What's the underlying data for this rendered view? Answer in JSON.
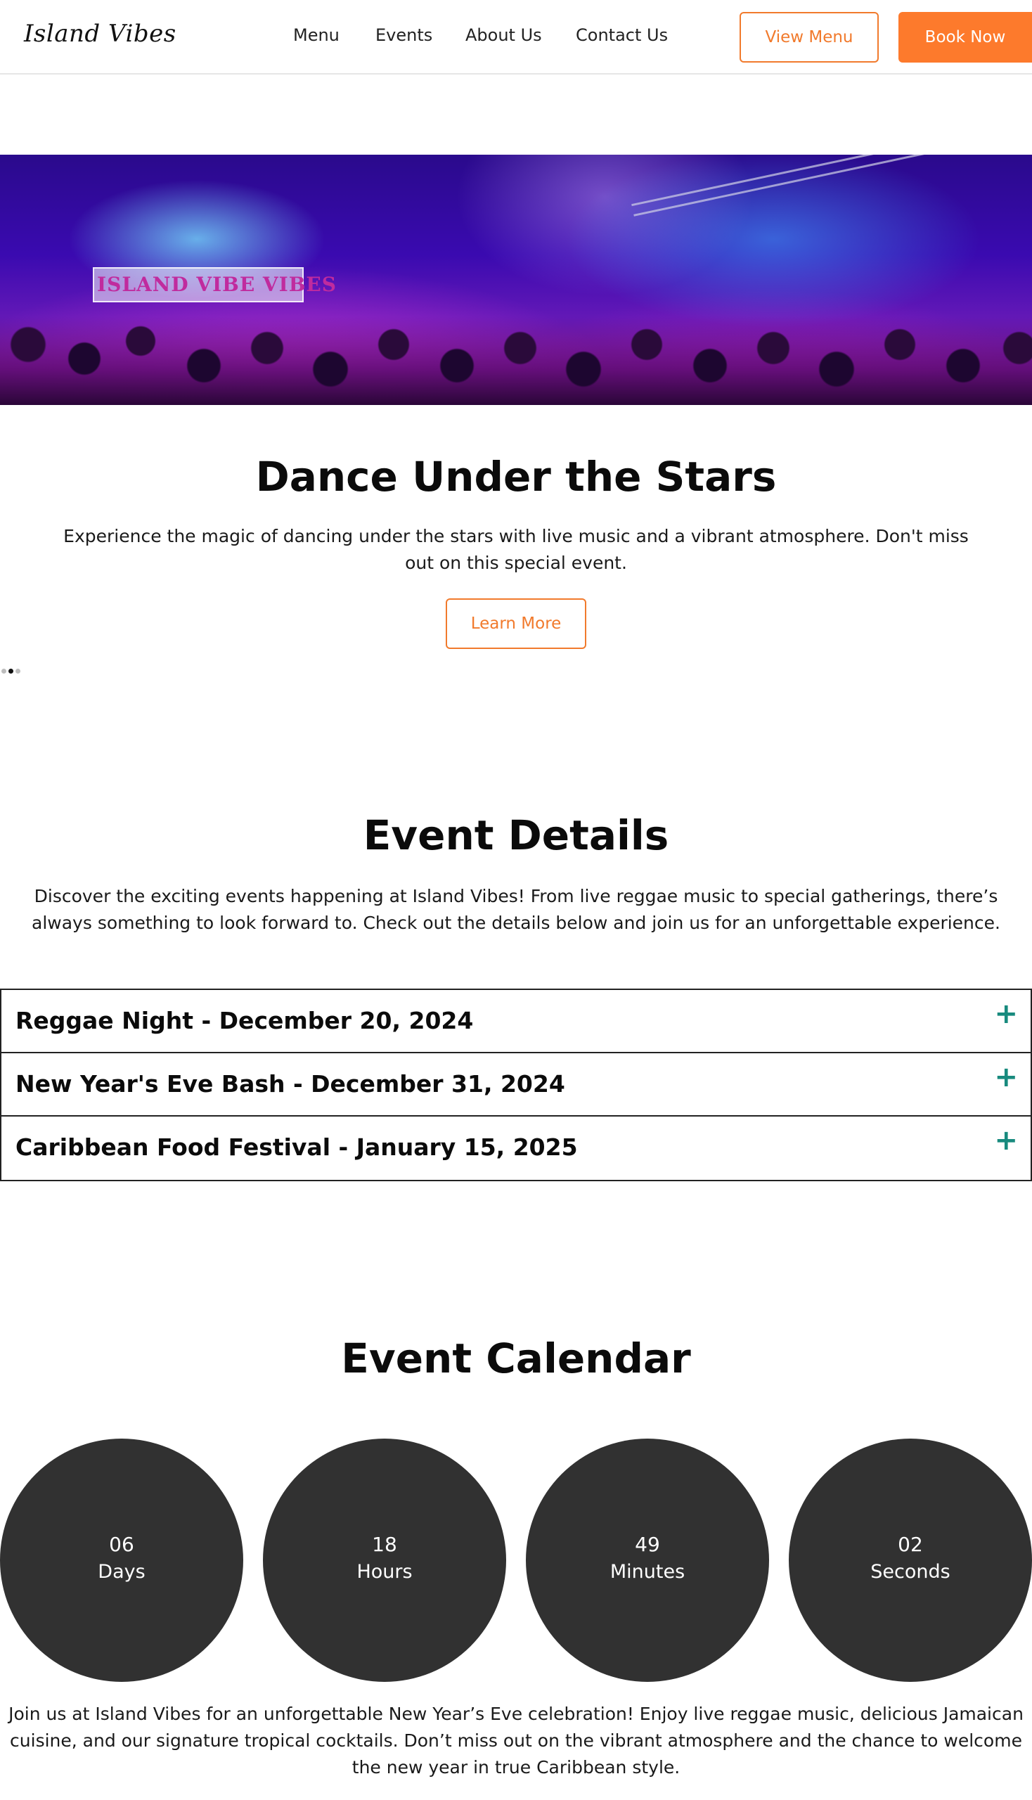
{
  "header": {
    "logo": "Island Vibes",
    "nav": [
      "Menu",
      "Events",
      "About Us",
      "Contact Us"
    ],
    "view_menu": "View Menu",
    "book_now": "Book Now"
  },
  "hero": {
    "image_banner_text": "ISLAND VIBE VIBES",
    "title": "Dance Under the Stars",
    "description": "Experience the magic of dancing under the stars with live music and a vibrant atmosphere. Don't miss out on this special event.",
    "learn_more": "Learn More",
    "slides_count": 3,
    "active_slide": 2
  },
  "event_details": {
    "title": "Event Details",
    "description": "Discover the exciting events happening at Island Vibes! From live reggae music to special gatherings, there’s always something to look forward to. Check out the details below and join us for an unforgettable experience.",
    "items": [
      "Reggae Night - December 20, 2024",
      "New Year's Eve Bash - December 31, 2024",
      "Caribbean Food Festival - January 15, 2025"
    ],
    "expand_icon": "+"
  },
  "event_calendar": {
    "title": "Event Calendar",
    "countdown": [
      {
        "value": "06",
        "label": "Days"
      },
      {
        "value": "18",
        "label": "Hours"
      },
      {
        "value": "49",
        "label": "Minutes"
      },
      {
        "value": "02",
        "label": "Seconds"
      }
    ],
    "description": "Join us at Island Vibes for an unforgettable New Year’s Eve celebration! Enjoy live reggae music, delicious Jamaican cuisine, and our signature tropical cocktails. Don’t miss out on the vibrant atmosphere and the chance to welcome the new year in true Caribbean style."
  },
  "colors": {
    "accent": "#fd7a2c",
    "accent_outline": "#f17a2c",
    "plus_icon": "#188a7e",
    "circle": "#313131"
  }
}
